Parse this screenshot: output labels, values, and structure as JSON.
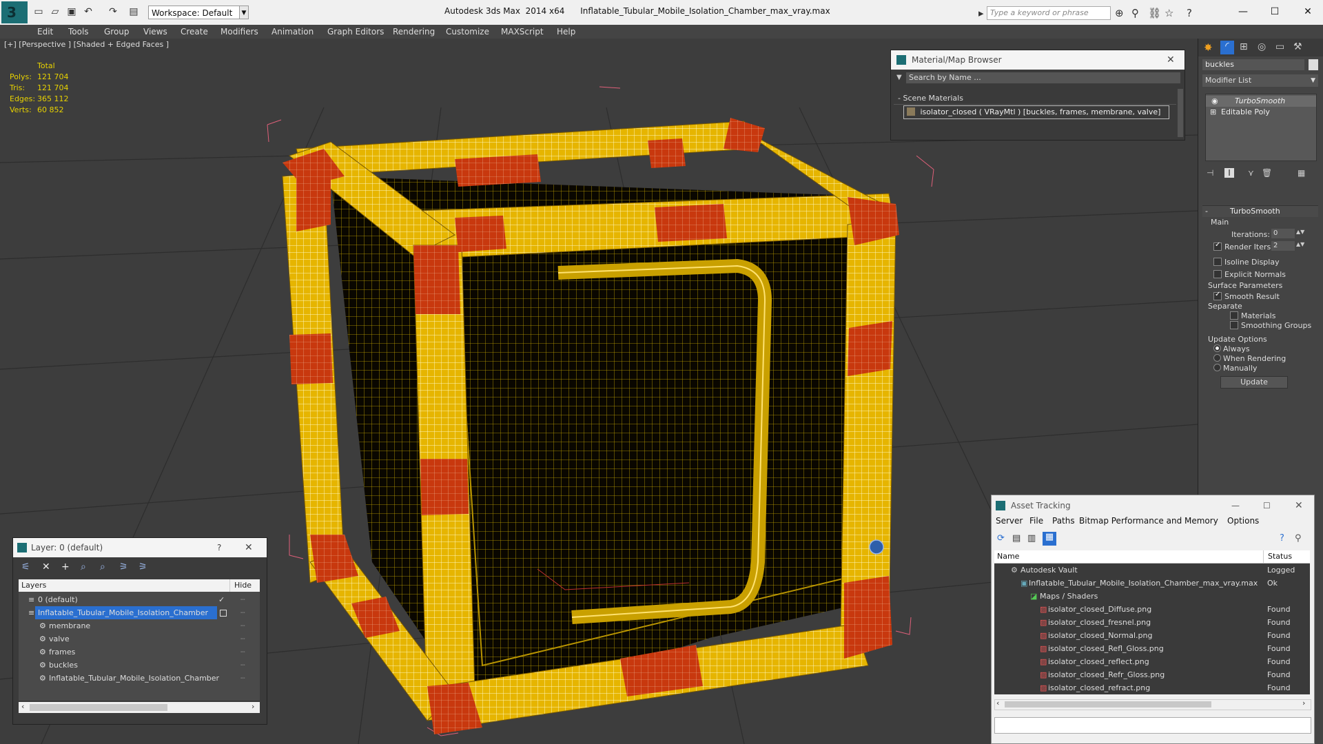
{
  "titlebar": {
    "workspace": "Workspace: Default",
    "app_title": "Autodesk 3ds Max  2014 x64      Inflatable_Tubular_Mobile_Isolation_Chamber_max_vray.max",
    "search_placeholder": "Type a keyword or phrase"
  },
  "menu": [
    "Edit",
    "Tools",
    "Group",
    "Views",
    "Create",
    "Modifiers",
    "Animation",
    "Graph Editors",
    "Rendering",
    "Customize",
    "MAXScript",
    "Help"
  ],
  "viewport": {
    "label": "[+] [Perspective ] [Shaded + Edged Faces ]",
    "stats": {
      "header": "Total",
      "rows": [
        {
          "label": "Polys:",
          "value": "121 704"
        },
        {
          "label": "Tris:",
          "value": "121 704"
        },
        {
          "label": "Edges:",
          "value": "365 112"
        },
        {
          "label": "Verts:",
          "value": "60 852"
        }
      ]
    }
  },
  "material_browser": {
    "title": "Material/Map Browser",
    "search_placeholder": "Search by Name ...",
    "section": "Scene Materials",
    "material": "isolator_closed  ( VRayMtl )  [buckles, frames, membrane, valve]"
  },
  "command_panel": {
    "object_name": "buckles",
    "modifier_list": "Modifier List",
    "stack": [
      "TurboSmooth",
      "Editable Poly"
    ],
    "rollout_title": "TurboSmooth",
    "main_label": "Main",
    "iterations_label": "Iterations:",
    "iterations_value": "0",
    "render_iters_label": "Render Iters:",
    "render_iters_value": "2",
    "isoline": "Isoline Display",
    "explicit_normals": "Explicit Normals",
    "surface_params": "Surface Parameters",
    "smooth_result": "Smooth Result",
    "separate": "Separate",
    "materials": "Materials",
    "smoothing_groups": "Smoothing Groups",
    "update_options": "Update Options",
    "always": "Always",
    "when_rendering": "When Rendering",
    "manually": "Manually",
    "update_button": "Update"
  },
  "layer_panel": {
    "title": "Layer: 0 (default)",
    "col_layers": "Layers",
    "col_hide": "Hide",
    "rows": [
      "0 (default)",
      "Inflatable_Tubular_Mobile_Isolation_Chamber",
      "membrane",
      "valve",
      "frames",
      "buckles",
      "Inflatable_Tubular_Mobile_Isolation_Chamber"
    ]
  },
  "asset_tracking": {
    "title": "Asset Tracking",
    "menu": [
      "Server",
      "File",
      "Paths",
      "Bitmap Performance and Memory",
      "Options"
    ],
    "col_name": "Name",
    "col_status": "Status",
    "rows": [
      {
        "name": "Autodesk Vault",
        "status": "Logged Out"
      },
      {
        "name": "Inflatable_Tubular_Mobile_Isolation_Chamber_max_vray.max",
        "status": "Ok"
      },
      {
        "name": "Maps / Shaders",
        "status": ""
      },
      {
        "name": "isolator_closed_Diffuse.png",
        "status": "Found"
      },
      {
        "name": "isolator_closed_fresnel.png",
        "status": "Found"
      },
      {
        "name": "isolator_closed_Normal.png",
        "status": "Found"
      },
      {
        "name": "isolator_closed_Refl_Gloss.png",
        "status": "Found"
      },
      {
        "name": "isolator_closed_reflect.png",
        "status": "Found"
      },
      {
        "name": "isolator_closed_Refr_Gloss.png",
        "status": "Found"
      },
      {
        "name": "isolator_closed_refract.png",
        "status": "Found"
      }
    ]
  },
  "colors": {
    "accent": "#1c6e74",
    "selection": "#2a6fd0",
    "tube_yellow": "#e8b800",
    "tube_red": "#c8380e"
  }
}
